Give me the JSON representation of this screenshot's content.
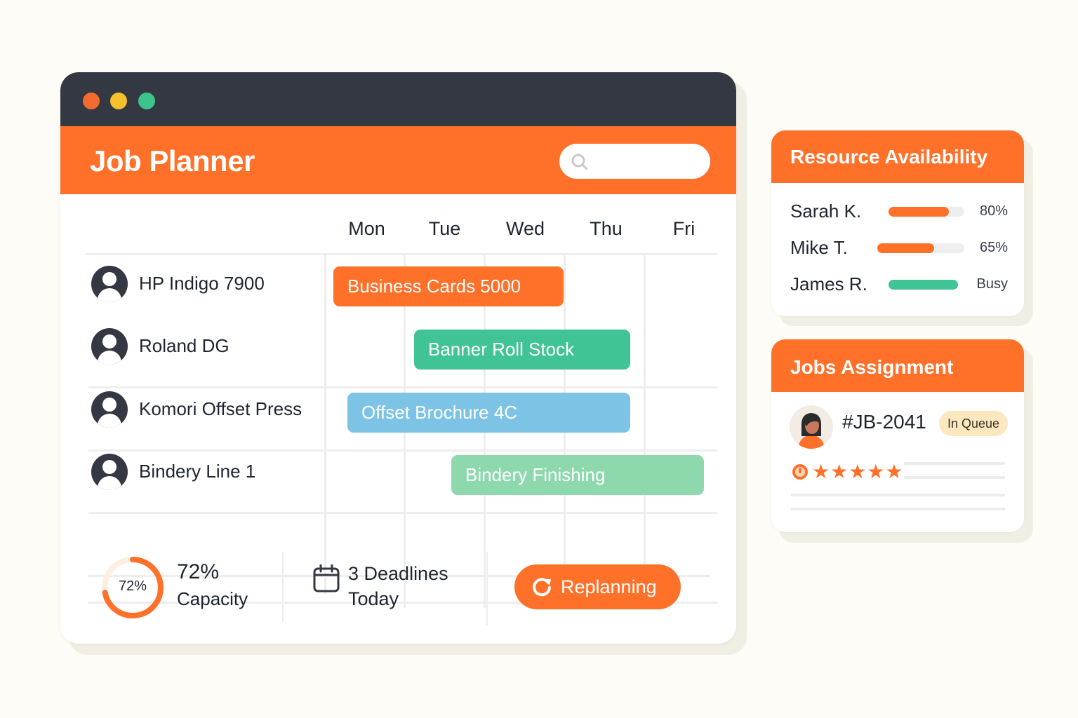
{
  "colors": {
    "accent": "#ff7029",
    "green": "#41c495",
    "blue": "#7cc3e6",
    "light_green": "#8ed8ae",
    "dark": "#343842",
    "dot_red": "#f26a2e",
    "dot_yellow": "#f6c12c",
    "dot_green": "#3cc48a"
  },
  "app": {
    "title": "Job Planner",
    "search_placeholder": ""
  },
  "schedule": {
    "days": [
      "Mon",
      "Tue",
      "Wed",
      "Thu",
      "Fri"
    ],
    "resources": [
      {
        "name": "HP Indigo 7900",
        "icon": "user-icon"
      },
      {
        "name": "Roland DG",
        "icon": "user-icon"
      },
      {
        "name": "Komori Offset Press",
        "icon": "user-icon"
      },
      {
        "name": "Bindery Line 1",
        "icon": "user-icon"
      }
    ],
    "jobs": [
      {
        "label": "Business Cards 5000",
        "color": "#ff7029"
      },
      {
        "label": "Banner Roll Stock",
        "color": "#41c495"
      },
      {
        "label": "Offset Brochure 4C",
        "color": "#7cc3e6"
      },
      {
        "label": "Bindery Finishing",
        "color": "#8ed8ae"
      }
    ]
  },
  "footer": {
    "capacity_percent": 72,
    "capacity_ring_text": "72%",
    "capacity_value": "72%",
    "capacity_label": "Capacity",
    "deadlines_line1": "3 Deadlines",
    "deadlines_line2": "Today",
    "replan_label": "Replanning",
    "replan_icon": "refresh-icon",
    "calendar_icon": "calendar-icon"
  },
  "resource_availability": {
    "title": "Resource Availability",
    "people": [
      {
        "name": "Sarah K.",
        "level": 0.8,
        "value": "80%",
        "color": "#ff7029"
      },
      {
        "name": "Mike T.",
        "level": 0.65,
        "value": "65%",
        "color": "#ff7029"
      },
      {
        "name": "James R.",
        "level": 1.0,
        "value": "Busy",
        "color": "#41c495"
      }
    ]
  },
  "jobs_assignment": {
    "title": "Jobs Assignment",
    "job_id": "#JB-2041",
    "status": "In Queue",
    "rating_stars": "★★★★★",
    "rating": 5
  }
}
